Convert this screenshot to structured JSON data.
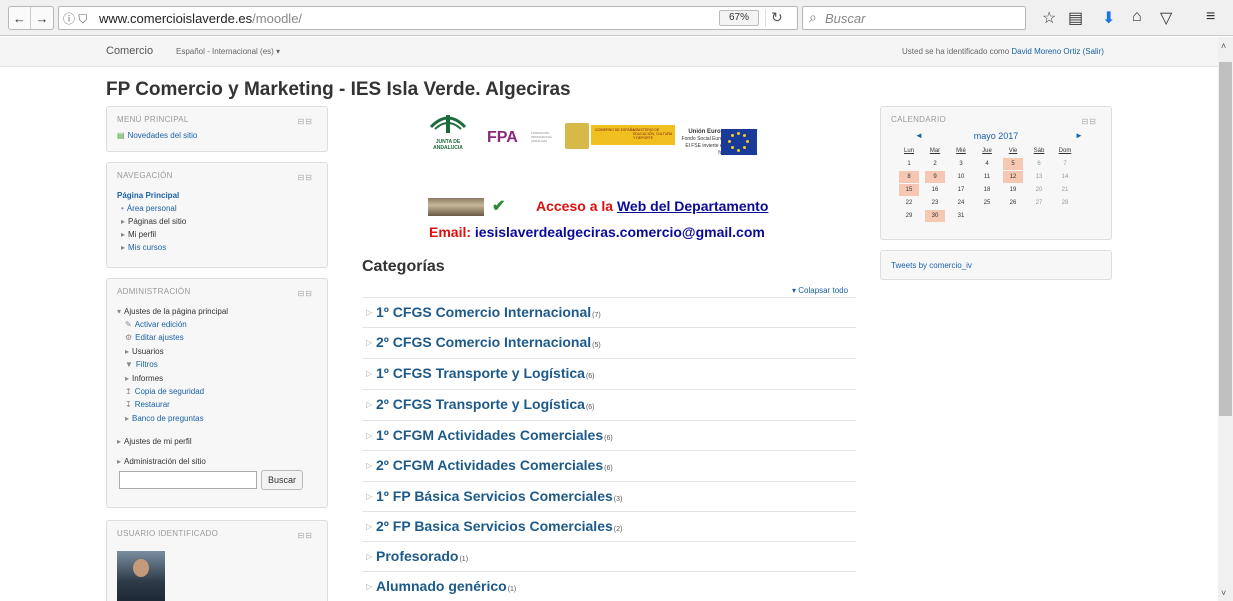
{
  "browser": {
    "url_base": "www.comercioislaverde.es",
    "url_path": "/moodle/",
    "zoom": "67%",
    "search_placeholder": "Buscar"
  },
  "header": {
    "brand": "Comercio",
    "language": "Español - Internacional (es) ▾",
    "login_prefix": "Usted se ha identificado como",
    "user_name": "David Moreno Ortiz",
    "logout": "(Salir)"
  },
  "page_title": "FP Comercio y Marketing - IES Isla Verde. Algeciras",
  "main_menu": {
    "title": "MENÚ PRINCIPAL",
    "items": [
      "Novedades del sitio"
    ]
  },
  "navigation": {
    "title": "NAVEGACIÓN",
    "home": "Página Principal",
    "items": [
      "Área personal",
      "Páginas del sitio",
      "Mi perfil",
      "Mis cursos"
    ]
  },
  "administration": {
    "title": "ADMINISTRACIÓN",
    "root": "Ajustes de la página principal",
    "items": [
      "Activar edición",
      "Editar ajustes",
      "Usuarios",
      "Filtros",
      "Informes",
      "Copia de seguridad",
      "Restaurar",
      "Banco de preguntas"
    ],
    "profile_settings": "Ajustes de mi perfil",
    "site_admin": "Administración del sitio",
    "search_button": "Buscar"
  },
  "user_block": {
    "title": "USUARIO IDENTIFICADO"
  },
  "logos": {
    "junta": "JUNTA DE ANDALUCIA",
    "fpa": "FPA",
    "fpa_sub": "FORMACIÓN PROFESIONAL ANDALUZA",
    "gobierno": "GOBIERNO DE ESPAÑA",
    "ministerio": "MINISTERIO DE EDUCACIÓN, CULTURA Y DEPORTE",
    "ue_title": "Unión Europea",
    "ue_sub1": "Fondo Social Europeo",
    "ue_sub2": "El FSE invierte en tu futuro"
  },
  "department": {
    "access_prefix": "Acceso a la",
    "access_link": "Web del Departamento",
    "email_label": "Email:",
    "email": "iesislaverdealgeciras.comercio@gmail.com"
  },
  "categories": {
    "title": "Categorías",
    "collapse_all": "Colapsar todo",
    "items": [
      {
        "name": "1º CFGS Comercio Internacional",
        "count": "(7)"
      },
      {
        "name": "2º CFGS Comercio Internacional",
        "count": "(5)"
      },
      {
        "name": "1º CFGS Transporte y Logística",
        "count": "(6)"
      },
      {
        "name": "2º CFGS Transporte y Logística",
        "count": "(6)"
      },
      {
        "name": "1º CFGM Actividades Comerciales",
        "count": "(6)"
      },
      {
        "name": "2º CFGM Actividades Comerciales",
        "count": "(6)"
      },
      {
        "name": "1º FP Básica Servicios Comerciales",
        "count": "(3)"
      },
      {
        "name": "2º FP Basica Servicios Comerciales",
        "count": "(2)"
      },
      {
        "name": "Profesorado",
        "count": "(1)"
      },
      {
        "name": "Alumnado genérico",
        "count": "(1)"
      }
    ]
  },
  "calendar": {
    "title": "CALENDARIO",
    "month": "mayo 2017",
    "days": [
      "Lun",
      "Mar",
      "Mié",
      "Jue",
      "Vie",
      "Sáb",
      "Dom"
    ],
    "weeks": [
      [
        "1",
        "2",
        "3",
        "4",
        "5",
        "6",
        "7"
      ],
      [
        "8",
        "9",
        "10",
        "11",
        "12",
        "13",
        "14"
      ],
      [
        "15",
        "16",
        "17",
        "18",
        "19",
        "20",
        "21"
      ],
      [
        "22",
        "23",
        "24",
        "25",
        "26",
        "27",
        "28"
      ],
      [
        "29",
        "30",
        "31",
        "",
        "",
        "",
        ""
      ]
    ],
    "event_days": [
      "5",
      "8",
      "9",
      "12",
      "15",
      "30"
    ]
  },
  "tweets": {
    "label": "Tweets by comercio_iv"
  }
}
